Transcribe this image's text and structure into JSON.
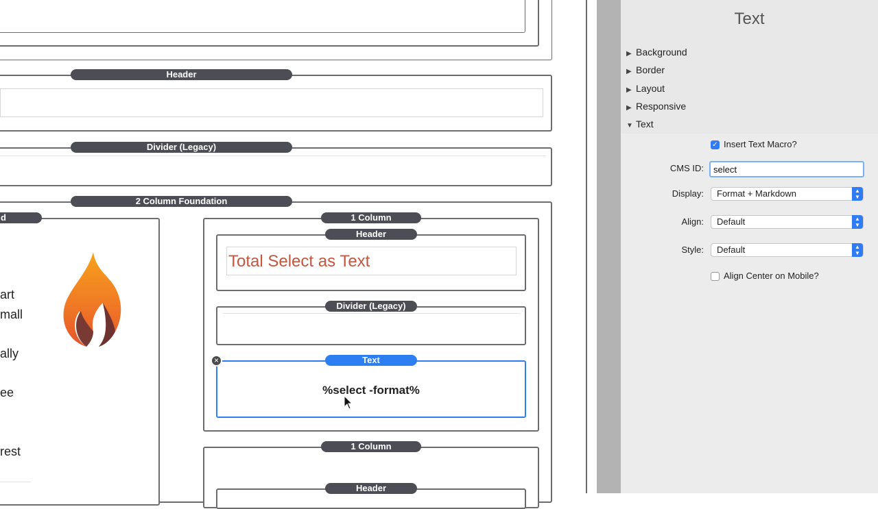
{
  "canvas": {
    "blocks": {
      "header_top": "Header",
      "divider_top": "Divider (Legacy)",
      "two_col": "2 Column Foundation",
      "left_col_partial": "d",
      "col1": "1 Column",
      "col1_header": "Header",
      "col1_header_text": "Total Select as Text",
      "col1_divider": "Divider (Legacy)",
      "col1_text": "Text",
      "col1_text_content": "%select -format%",
      "col2": "1 Column",
      "col2_header": "Header"
    },
    "left_fragments": [
      "art",
      "mall",
      "ally",
      "ee",
      "rest"
    ],
    "close_icon": "×"
  },
  "panel": {
    "title": "Text",
    "sections": [
      {
        "label": "Background",
        "expanded": false
      },
      {
        "label": "Border",
        "expanded": false
      },
      {
        "label": "Layout",
        "expanded": false
      },
      {
        "label": "Responsive",
        "expanded": false
      },
      {
        "label": "Text",
        "expanded": true
      }
    ],
    "insert_macro": {
      "label": "Insert Text Macro?",
      "checked": true
    },
    "cms_id": {
      "label": "CMS ID:",
      "value": "select"
    },
    "display": {
      "label": "Display:",
      "value": "Format + Markdown"
    },
    "align": {
      "label": "Align:",
      "value": "Default"
    },
    "style": {
      "label": "Style:",
      "value": "Default"
    },
    "align_center_mobile": {
      "label": "Align Center on Mobile?",
      "checked": false
    }
  },
  "colors": {
    "accent": "#2f7cf6",
    "pill": "#4d4d55",
    "header_text": "#c8553d"
  }
}
